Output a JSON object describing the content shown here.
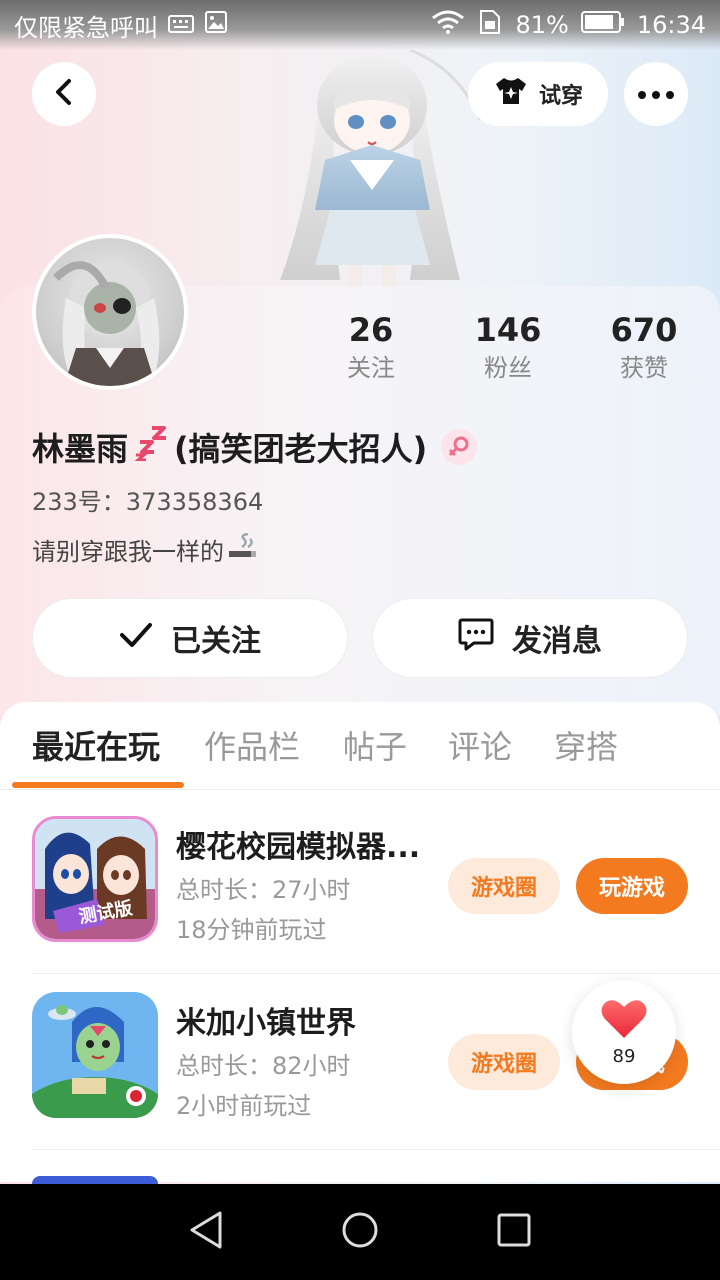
{
  "status_bar": {
    "carrier_text": "仅限紧急呼叫",
    "battery": "81%",
    "time": "16:34"
  },
  "header": {
    "try_on_label": "试穿"
  },
  "profile": {
    "stats": [
      {
        "value": "26",
        "label": "关注"
      },
      {
        "value": "146",
        "label": "粉丝"
      },
      {
        "value": "670",
        "label": "获赞"
      }
    ],
    "name": "林墨雨",
    "name_suffix": "(搞笑团老大招人)",
    "uid": "233号：373358364",
    "bio": "请别穿跟我一样的",
    "follow_button": "已关注",
    "message_button": "发消息"
  },
  "tabs": [
    {
      "label": "最近在玩",
      "active": true
    },
    {
      "label": "作品栏",
      "active": false
    },
    {
      "label": "帖子",
      "active": false
    },
    {
      "label": "评论",
      "active": false
    },
    {
      "label": "穿搭",
      "active": false
    }
  ],
  "games": [
    {
      "title": "樱花校园模拟器...",
      "duration": "总时长：27小时",
      "last_played": "18分钟前玩过",
      "circle_label": "游戏圈",
      "play_label": "玩游戏",
      "icon_badge": "测试版"
    },
    {
      "title": "米加小镇世界",
      "duration": "总时长：82小时",
      "last_played": "2小时前玩过",
      "circle_label": "游戏圈",
      "play_label": "玩游戏"
    }
  ],
  "favorite": {
    "count": "89"
  },
  "colors": {
    "accent": "#f47a1f",
    "accent_light": "#fdeadb"
  }
}
